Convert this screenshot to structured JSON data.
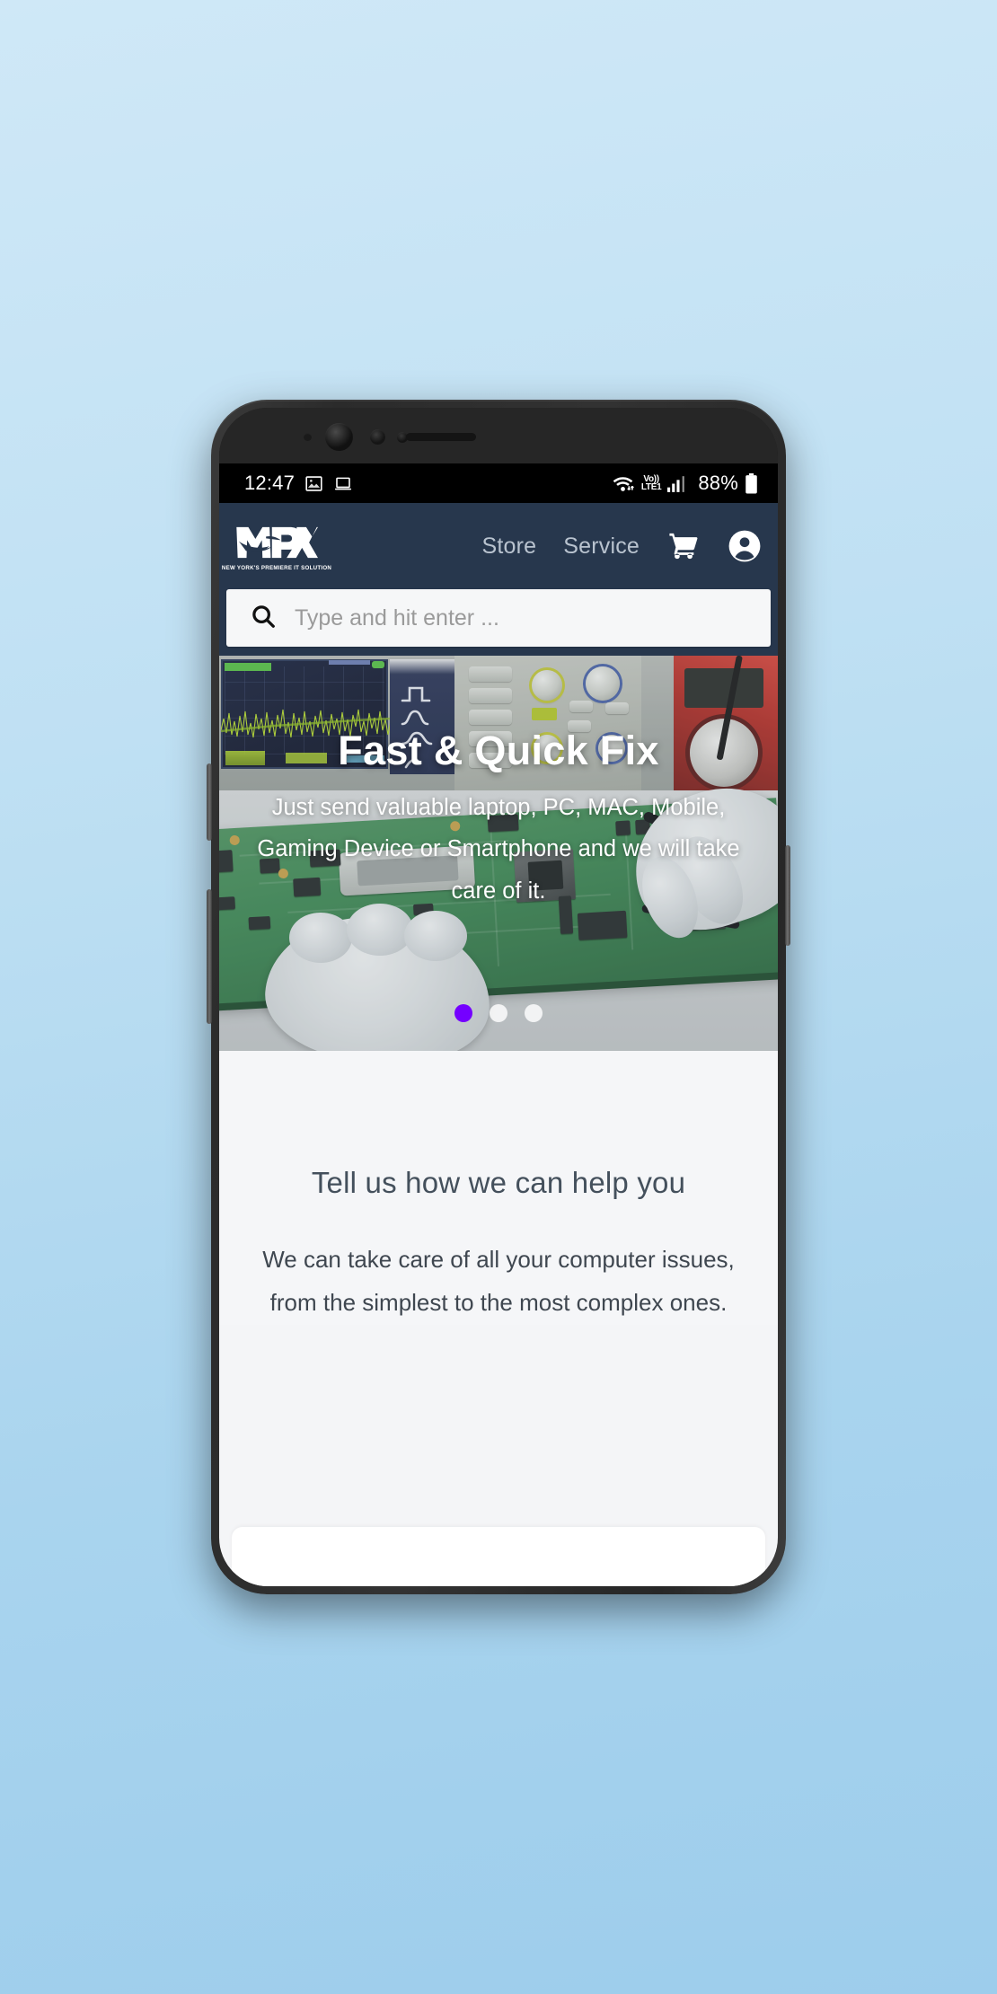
{
  "statusbar": {
    "time": "12:47",
    "icons_left": [
      "image-icon",
      "laptop-icon"
    ],
    "wifi": "wifi-icon",
    "volte_top": "Vo))",
    "volte_bottom": "LTE1",
    "signal": "signal-bars-icon",
    "battery_pct": "88%",
    "battery": "battery-icon"
  },
  "header": {
    "logo_text": "MPX",
    "logo_tagline": "NEW YORK'S PREMIERE IT SOLUTION",
    "nav": [
      {
        "label": "Store",
        "name": "nav-link-store"
      },
      {
        "label": "Service",
        "name": "nav-link-service"
      }
    ],
    "cart_icon": "shopping-cart-icon",
    "account_icon": "account-circle-icon",
    "bg_color": "#27374d"
  },
  "search": {
    "icon": "search-icon",
    "value": "",
    "placeholder": "Type and hit enter ..."
  },
  "hero": {
    "title": "Fast & Quick Fix",
    "subtitle": "Just send valuable laptop, PC, MAC, Mobile, Gaming Device or Smartphone and we will take care of it.",
    "dots": [
      {
        "active": true,
        "name": "carousel-dot-1"
      },
      {
        "active": false,
        "name": "carousel-dot-2"
      },
      {
        "active": false,
        "name": "carousel-dot-3"
      }
    ],
    "active_dot_color": "#7400ff",
    "inactive_dot_color": "#ffffff"
  },
  "help": {
    "title": "Tell us how we can help you",
    "body": "We can take care of all your computer issues, from the simplest to the most complex ones."
  }
}
